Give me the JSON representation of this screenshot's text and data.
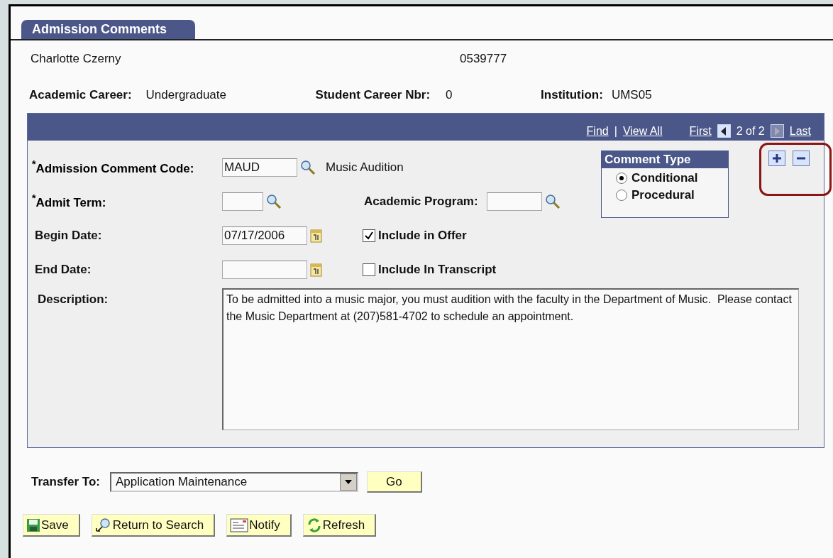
{
  "tab": {
    "label": "Admission Comments",
    "selected": true
  },
  "student": {
    "name": "Charlotte Czerny",
    "id": "0539777"
  },
  "career_fields": [
    {
      "label": "Academic Career:",
      "value": "Undergraduate"
    },
    {
      "label": "Student Career Nbr:",
      "value": "0"
    },
    {
      "label": "Institution:",
      "value": "UMS05"
    }
  ],
  "navigation": {
    "links": [
      "Find",
      "View All"
    ],
    "separator": "|",
    "first": "First",
    "position": "2 of 2",
    "last": "Last",
    "prev_enabled": true,
    "next_enabled": false
  },
  "form": {
    "comment_code": {
      "label": "$^{*}$Admission Comment Code:",
      "value": "MAUD",
      "description": "Music Audition"
    },
    "admit_term": {
      "label": "$^{*}$Admit Term:"
    },
    "academic_program": {
      "label": "Academic Program:"
    },
    "begin_date": {
      "label": "Begin Date:",
      "value": "07/17/2006"
    },
    "end_date": {
      "label": "End Date:"
    },
    "checkboxes": [
      {
        "label": "Include in Offer",
        "checked": true
      },
      {
        "label": "Include In Transcript",
        "checked": false
      }
    ],
    "comment_type": {
      "title": "Comment Type",
      "options": [
        {
          "label": "Conditional",
          "selected": true
        },
        {
          "label": "Procedural",
          "selected": false
        }
      ]
    },
    "description": {
      "label": "Description:",
      "value": "To be admitted into a music major, you must audition with the faculty in the Department of Music.  Please contact the Music Department at (207)581-4702 to schedule an appointment."
    }
  },
  "transfer": {
    "label": "Transfer To:",
    "value": "Application Maintenance",
    "button": "Go"
  },
  "buttons": [
    {
      "kind": "save",
      "label": "Save"
    },
    {
      "kind": "search",
      "label": "Return to Search"
    },
    {
      "kind": "notify",
      "label": "Notify"
    },
    {
      "kind": "refresh",
      "label": "Refresh"
    }
  ]
}
